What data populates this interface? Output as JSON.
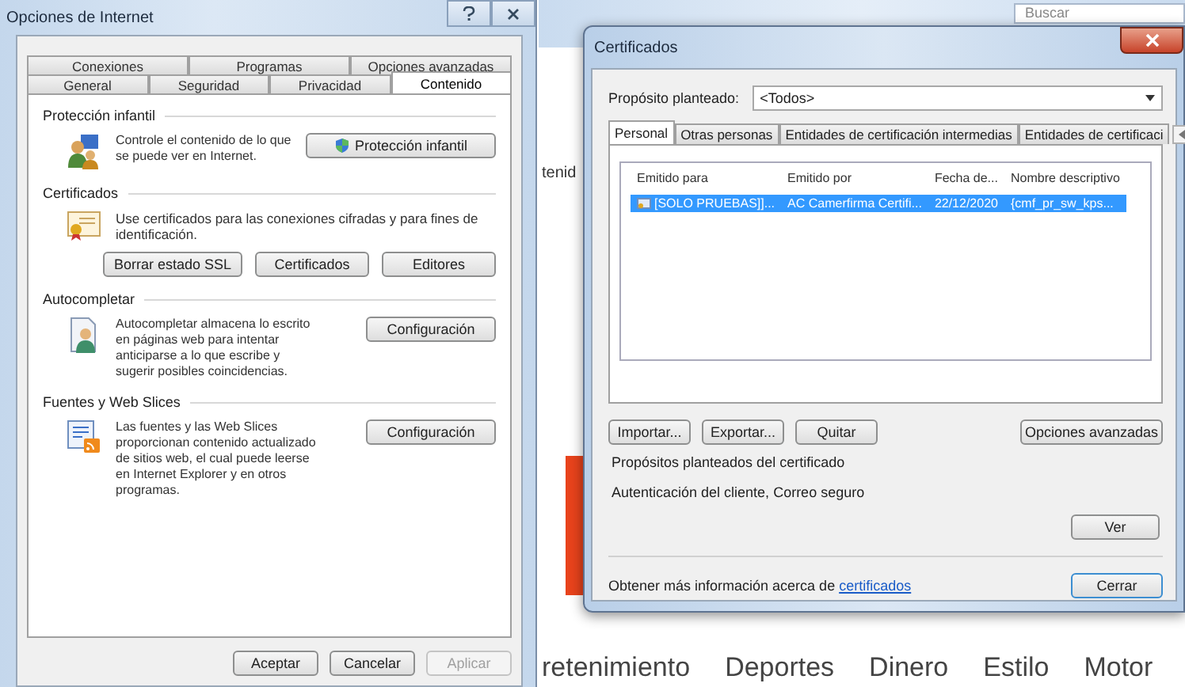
{
  "background": {
    "search": "Buscar",
    "fragment": "tenid",
    "nav": [
      "retenimiento",
      "Deportes",
      "Dinero",
      "Estilo",
      "Motor"
    ]
  },
  "internet_options": {
    "title": "Opciones de Internet",
    "tab_rows": [
      [
        {
          "label": "Conexiones",
          "selected": false
        },
        {
          "label": "Programas",
          "selected": false
        },
        {
          "label": "Opciones avanzadas",
          "selected": false
        }
      ],
      [
        {
          "label": "General",
          "selected": false
        },
        {
          "label": "Seguridad",
          "selected": false
        },
        {
          "label": "Privacidad",
          "selected": false
        },
        {
          "label": "Contenido",
          "selected": true
        }
      ]
    ],
    "sections": [
      {
        "title": "Protección infantil",
        "kind": "family",
        "text": "Controle el contenido de lo que se puede ver en Internet.",
        "buttons": [
          {
            "label": "Protección infantil",
            "kind": "shield"
          }
        ]
      },
      {
        "title": "Certificados",
        "kind": "certificate",
        "text": "Use certificados para las conexiones cifradas y para fines de identificación.",
        "buttons": [
          {
            "label": "Borrar estado SSL",
            "kind": "plain"
          },
          {
            "label": "Certificados",
            "kind": "plain"
          },
          {
            "label": "Editores",
            "kind": "plain"
          }
        ]
      },
      {
        "title": "Autocompletar",
        "kind": "autocomplete",
        "text": "Autocompletar almacena lo escrito en páginas web para intentar anticiparse a lo que escribe y sugerir posibles coincidencias.",
        "buttons": [
          {
            "label": "Configuración",
            "kind": "plain"
          }
        ]
      },
      {
        "title": "Fuentes y Web Slices",
        "kind": "feeds",
        "text": "Las fuentes y las Web Slices proporcionan contenido actualizado de sitios web, el cual puede leerse en Internet Explorer y en otros programas.",
        "buttons": [
          {
            "label": "Configuración",
            "kind": "plain"
          }
        ]
      }
    ],
    "footer_buttons": [
      {
        "label": "Aceptar",
        "disabled": false
      },
      {
        "label": "Cancelar",
        "disabled": false
      },
      {
        "label": "Aplicar",
        "disabled": true
      }
    ]
  },
  "certificates": {
    "title": "Certificados",
    "purpose_label": "Propósito planteado:",
    "purpose_value": "<Todos>",
    "tabs": [
      {
        "label": "Personal",
        "selected": true
      },
      {
        "label": "Otras personas",
        "selected": false
      },
      {
        "label": "Entidades de certificación intermedias",
        "selected": false
      },
      {
        "label": "Entidades de certificaci",
        "selected": false
      }
    ],
    "table": {
      "columns": [
        "Emitido para",
        "Emitido por",
        "Fecha de...",
        "Nombre descriptivo"
      ],
      "rows": [
        {
          "cells": [
            "[SOLO PRUEBAS]]...",
            "AC Camerfirma Certifi...",
            "22/12/2020",
            "{cmf_pr_sw_kps..."
          ],
          "selected": true
        }
      ]
    },
    "actions": [
      "Importar...",
      "Exportar...",
      "Quitar"
    ],
    "advanced": "Opciones avanzadas",
    "purposes_title": "Propósitos planteados del certificado",
    "purposes": "Autenticación del cliente, Correo seguro",
    "view": "Ver",
    "info_text": "Obtener más información acerca de",
    "info_link": "certificados",
    "close": "Cerrar"
  }
}
